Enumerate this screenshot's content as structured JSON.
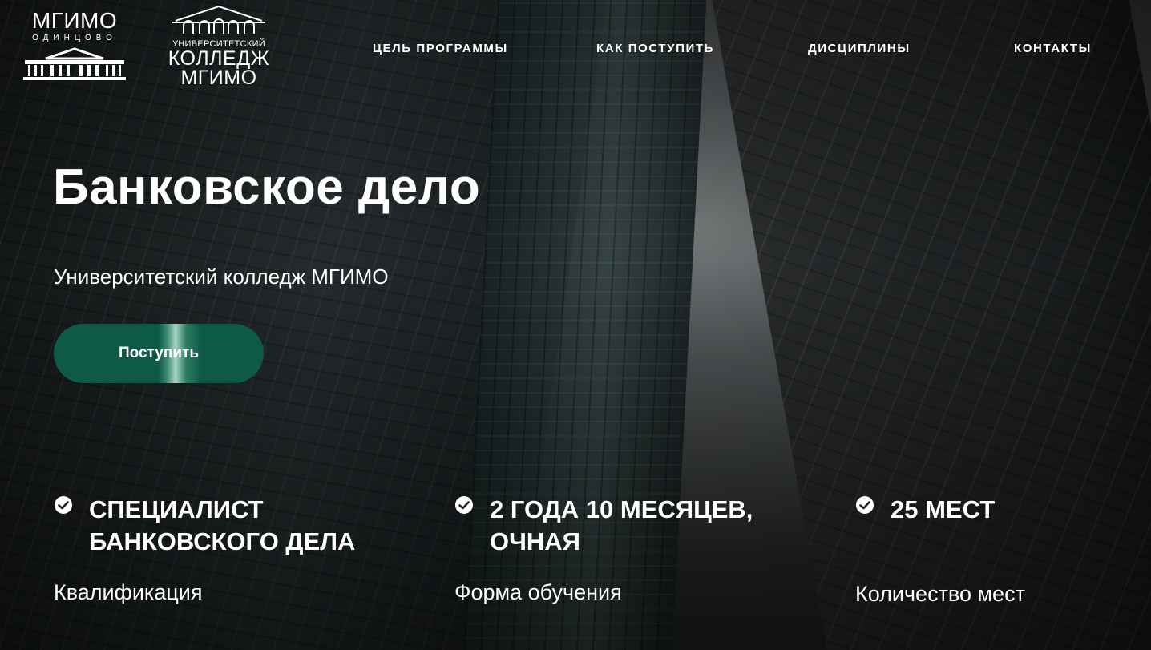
{
  "header": {
    "logo_left": {
      "title": "МГИМО",
      "subtitle": "ОДИНЦОВО"
    },
    "logo_right": {
      "line1": "УНИВЕРСИТЕТСКИЙ",
      "line2": "КОЛЛЕДЖ",
      "line3": "МГИМО"
    },
    "nav": [
      {
        "label": "ЦЕЛЬ ПРОГРАММЫ"
      },
      {
        "label": "КАК ПОСТУПИТЬ"
      },
      {
        "label": "ДИСЦИПЛИНЫ"
      },
      {
        "label": "КОНТАКТЫ"
      }
    ]
  },
  "hero": {
    "title": "Банковское дело",
    "subtitle": "Университетский колледж МГИМО",
    "cta_label": "Поступить"
  },
  "features": [
    {
      "value_line1": "СПЕЦИАЛИСТ",
      "value_line2": "БАНКОВСКОГО ДЕЛА",
      "label": "Квалификация"
    },
    {
      "value_line1": "2 ГОДА 10 МЕСЯЦЕВ,",
      "value_line2": "ОЧНАЯ",
      "label": "Форма обучения"
    },
    {
      "value_line1": "25 МЕСТ",
      "value_line2": "",
      "label": "Количество мест"
    }
  ],
  "colors": {
    "accent": "#0f5a45",
    "text": "#ffffff"
  },
  "icons": {
    "feature_icon": "check-circle-icon"
  }
}
